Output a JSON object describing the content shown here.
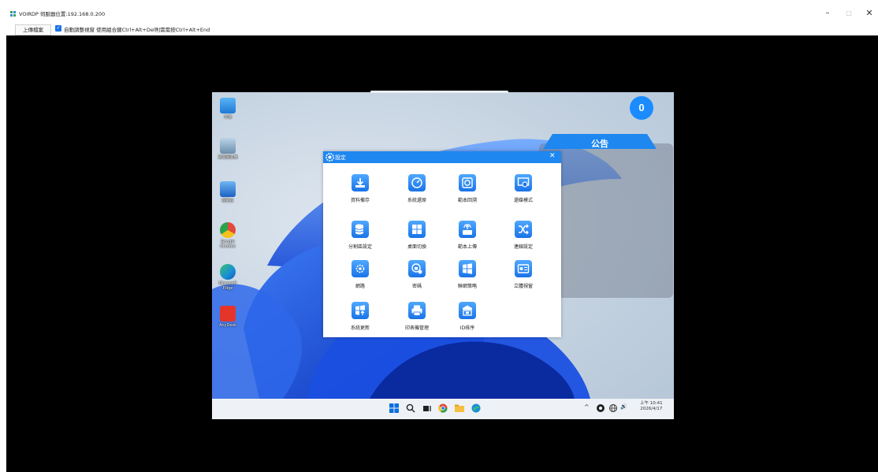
{
  "window": {
    "title": "VOIRDP 伺服器位置:192.168.0.200",
    "minimize": "–",
    "maximize": "□",
    "close": "✕"
  },
  "toolbar": {
    "upload_label": "上傳檔案",
    "auto_check": "✓",
    "auto_label": "自動調整視窗  使用組合鍵Ctrl+Alt+Del則需需按Ctrl+Alt+End"
  },
  "desktop": {
    "icons": [
      {
        "name": "desktop-icon-this-pc",
        "label": "本機",
        "color": "#3a9be8"
      },
      {
        "name": "desktop-icon-recycle-bin",
        "label": "資源回收筒",
        "color": "#8fb0c8"
      },
      {
        "name": "desktop-icon-control-panel",
        "label": "控制台",
        "color": "#2f7fd6"
      },
      {
        "name": "desktop-icon-google-chrome",
        "label": "Google Chrome",
        "color": "#e24a3b"
      },
      {
        "name": "desktop-icon-microsoft-edge",
        "label": "Microsoft Edge",
        "color": "#1a8fd6"
      },
      {
        "name": "desktop-icon-anydesk",
        "label": "AnyDesk",
        "color": "#e5352b"
      }
    ],
    "counter": "0",
    "notice_title": "公告",
    "clock_period": "上午 10:41",
    "clock_date": "2026/4/17",
    "tray": {
      "chevron": "^",
      "speaker": "🔊"
    }
  },
  "dialog": {
    "title": "設定",
    "close": "✕",
    "tiles": [
      {
        "name": "tile-data-backup",
        "label": "資料備存"
      },
      {
        "name": "tile-system-restore",
        "label": "系統還原"
      },
      {
        "name": "tile-version-rollback",
        "label": "範本回溯"
      },
      {
        "name": "tile-restore-mode",
        "label": "還碟模式"
      },
      {
        "name": "tile-partition-setup",
        "label": "分割區設定"
      },
      {
        "name": "tile-desktop-switch",
        "label": "桌面切換"
      },
      {
        "name": "tile-version-upload",
        "label": "範本上傳"
      },
      {
        "name": "tile-connection-setup",
        "label": "連線設定"
      },
      {
        "name": "tile-network",
        "label": "網路"
      },
      {
        "name": "tile-password",
        "label": "密碼"
      },
      {
        "name": "tile-networking-policy",
        "label": "聯網策略"
      },
      {
        "name": "tile-instant-window",
        "label": "立體視窗"
      },
      {
        "name": "tile-system-update",
        "label": "系統更新"
      },
      {
        "name": "tile-printer-manage",
        "label": "印表機管理"
      },
      {
        "name": "tile-id-sort",
        "label": "ID排序"
      }
    ]
  },
  "colors": {
    "accent": "#1e87f0",
    "remote_bg": "#000000",
    "badge": "#1a8cff"
  }
}
